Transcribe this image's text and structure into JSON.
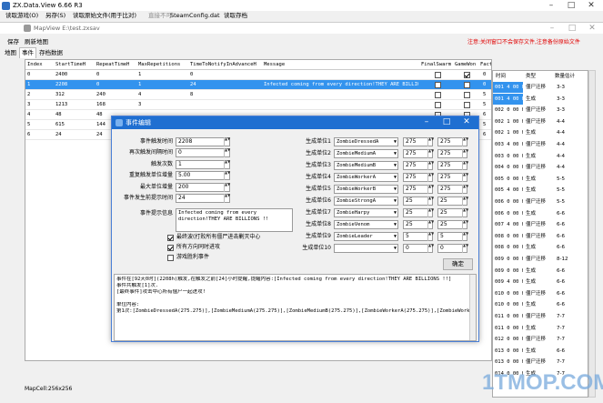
{
  "app": {
    "title": "ZX.Data.View 6.66 R3",
    "status": "MapCell:256x256"
  },
  "menu": [
    "读取游戏(O)",
    "另存(S)",
    "读取原始文件(用于比对)",
    "直接不可",
    "SteamConfig.dat",
    "读取存档"
  ],
  "child": {
    "title": "MapView E:\\test.zxsav",
    "menu": [
      "保存",
      "刷新地图"
    ],
    "tabs": [
      "地图",
      "事件",
      "存档数据"
    ],
    "notice": "注意:关闭窗口不会保存文件,注意备份原始文件"
  },
  "table": {
    "headers": [
      "Index",
      "StartTimeH",
      "RepeatTimeH",
      "MaxRepetitions",
      "TimeToNotifyInAdvanceH",
      "Message",
      "FinalSwarm",
      "GameWon",
      "Fact"
    ],
    "rows": [
      [
        "0",
        "2400",
        "0",
        "1",
        "0",
        "",
        false,
        true,
        "0"
      ],
      [
        "1",
        "2208",
        "0",
        "1",
        "24",
        "Infected coming from every direction!THEY ARE BILLIONS !!",
        false,
        false,
        "0"
      ],
      [
        "2",
        "312",
        "240",
        "4",
        "8",
        "",
        false,
        false,
        "5"
      ],
      [
        "3",
        "1213",
        "168",
        "3",
        "",
        "",
        false,
        false,
        "5"
      ],
      [
        "4",
        "48",
        "48",
        "",
        "",
        "",
        false,
        false,
        "6"
      ],
      [
        "5",
        "615",
        "144",
        "",
        "",
        "",
        false,
        false,
        "5"
      ],
      [
        "6",
        "24",
        "24",
        "",
        "",
        "",
        false,
        false,
        "6"
      ]
    ]
  },
  "right_table": {
    "headers": [
      "时间",
      "类型",
      "数量估计"
    ],
    "rows": [
      [
        "001 4 00 h",
        "僵尸迁移",
        "3-3"
      ],
      [
        "001 4 00 h",
        "生成",
        "3-3"
      ],
      [
        "002 0 00 h",
        "僵尸迁移",
        "3-3"
      ],
      [
        "002 1 00 h",
        "僵尸迁移",
        "4-4"
      ],
      [
        "002 1 00 h",
        "生成",
        "4-4"
      ],
      [
        "003 4 00 h",
        "僵尸迁移",
        "4-4"
      ],
      [
        "003 0 00 h",
        "生成",
        "4-4"
      ],
      [
        "004 0 00 h",
        "僵尸迁移",
        "4-4"
      ],
      [
        "005 0 00 h",
        "生成",
        "5-5"
      ],
      [
        "005 4 00 h",
        "生成",
        "5-5"
      ],
      [
        "006 0 00 h",
        "僵尸迁移",
        "5-5"
      ],
      [
        "006 0 00 h",
        "生成",
        "6-6"
      ],
      [
        "007 4 00 h",
        "僵尸迁移",
        "6-6"
      ],
      [
        "008 0 00 h",
        "僵尸迁移",
        "6-6"
      ],
      [
        "008 0 00 h",
        "生成",
        "6-6"
      ],
      [
        "009 0 00 h",
        "僵尸迁移",
        "8-12"
      ],
      [
        "009 0 00 h",
        "生成",
        "6-6"
      ],
      [
        "009 4 00 h",
        "生成",
        "6-6"
      ],
      [
        "010 0 00 h",
        "僵尸迁移",
        "6-6"
      ],
      [
        "010 0 00 h",
        "生成",
        "6-6"
      ],
      [
        "011 0 00 h",
        "僵尸迁移",
        "7-7"
      ],
      [
        "011 0 00 h",
        "生成",
        "7-7"
      ],
      [
        "012 0 00 h",
        "僵尸迁移",
        "7-7"
      ],
      [
        "013 0 00 h",
        "生成",
        "6-6"
      ],
      [
        "013 0 00 h",
        "僵尸迁移",
        "7-7"
      ],
      [
        "014 0 00 h",
        "生成",
        "7-7"
      ]
    ]
  },
  "dialog": {
    "title": "事件编辑",
    "fields": [
      {
        "label": "事件触发时间",
        "value": "2208"
      },
      {
        "label": "再次触发间隔时间",
        "value": "0"
      },
      {
        "label": "触发次数",
        "value": "1"
      },
      {
        "label": "重复触发单位增量",
        "value": "5.00"
      },
      {
        "label": "最大单位增量",
        "value": "200"
      },
      {
        "label": "事件发生前提示时间",
        "value": "24"
      }
    ],
    "msg_label": "事件提示信息",
    "msg_value": "Infected coming from every direction!THEY ARE BILLIONS !!",
    "checks": [
      {
        "label": "最终波(打败所有僵尸进击剿灭中心",
        "on": true
      },
      {
        "label": "所有方向同时进攻",
        "on": true
      },
      {
        "label": "游戏胜利事件",
        "on": false
      }
    ],
    "spawns": [
      {
        "label": "生成单位1",
        "unit": "ZombieDressedA",
        "a": "275",
        "b": "275"
      },
      {
        "label": "生成单位2",
        "unit": "ZombieMediumA",
        "a": "275",
        "b": "275"
      },
      {
        "label": "生成单位3",
        "unit": "ZombieMediumB",
        "a": "275",
        "b": "275"
      },
      {
        "label": "生成单位4",
        "unit": "ZombieWorkerA",
        "a": "275",
        "b": "275"
      },
      {
        "label": "生成单位5",
        "unit": "ZombieWorkerB",
        "a": "275",
        "b": "275"
      },
      {
        "label": "生成单位6",
        "unit": "ZombieStrongA",
        "a": "25",
        "b": "25"
      },
      {
        "label": "生成单位7",
        "unit": "ZombieHarpy",
        "a": "25",
        "b": "25"
      },
      {
        "label": "生成单位8",
        "unit": "ZombieVenom",
        "a": "25",
        "b": "25"
      },
      {
        "label": "生成单位9",
        "unit": "ZombieLeader",
        "a": "5",
        "b": "5"
      },
      {
        "label": "生成单位10",
        "unit": "",
        "a": "0",
        "b": "0"
      }
    ],
    "ok": "确定",
    "log": [
      "事件在[92天0时](2208h)触发,在触发之前[24]小时提醒,提醒内容:[Infected coming from every direction!THEY ARE BILLIONS !!]",
      "事件共触发[1]次.",
      "[最终事件]攻击中心所有僵尸一起进攻!",
      "",
      "单位内容:",
      "第1次:[ZombieDressedA(275.275)],[ZombieMediumA(275.275)],[ZombieMediumB(275.275)],[ZombieWorkerA(275.275)],[ZombieWorkerB"
    ]
  }
}
